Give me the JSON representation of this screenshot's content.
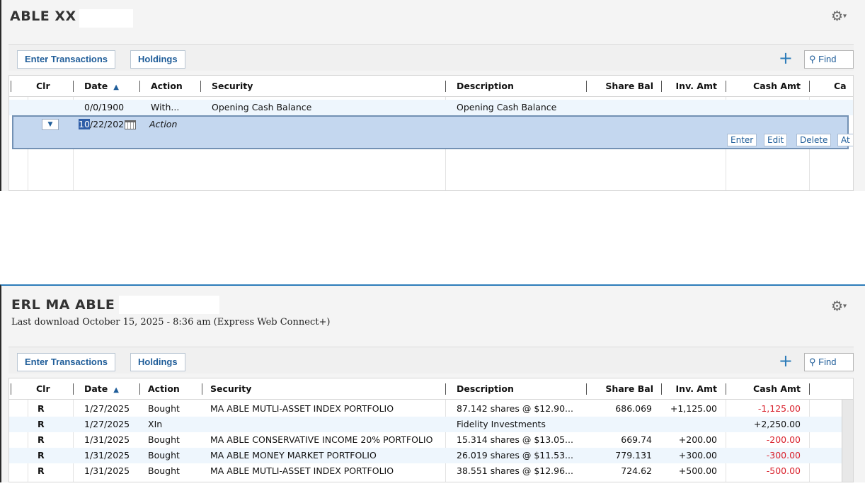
{
  "panel1": {
    "title": "ABLE XX",
    "toolbar": {
      "enter_label": "Enter Transactions",
      "holdings_label": "Holdings",
      "find_label": "Find"
    },
    "columns": [
      "Clr",
      "Date",
      "Action",
      "Security",
      "Description",
      "Share Bal",
      "Inv. Amt",
      "Cash Amt",
      "Ca"
    ],
    "rows": [
      {
        "clr": "",
        "date": "0/0/1900",
        "action": "With...",
        "security": "Opening Cash Balance",
        "description": "Opening Cash Balance",
        "share_bal": "",
        "inv_amt": "",
        "cash_amt": ""
      }
    ],
    "edit_row": {
      "date_selected": "10",
      "date_rest": "/22/202",
      "action_placeholder": "Action",
      "buttons": {
        "enter": "Enter",
        "edit": "Edit",
        "delete": "Delete",
        "attach": "At"
      }
    }
  },
  "panel2": {
    "title": "ERL MA ABLE",
    "subtitle": "Last download October 15, 2025 - 8:36 am (Express Web Connect+)",
    "toolbar": {
      "enter_label": "Enter Transactions",
      "holdings_label": "Holdings",
      "find_label": "Find"
    },
    "columns": [
      "Clr",
      "Date",
      "Action",
      "Security",
      "Description",
      "Share Bal",
      "Inv. Amt",
      "Cash Amt"
    ],
    "rows": [
      {
        "clr": "R",
        "date": "1/27/2025",
        "action": "Bought",
        "security": "MA ABLE MUTLI-ASSET INDEX PORTFOLIO",
        "description": "87.142 shares @ $12.90...",
        "share_bal": "686.069",
        "inv_amt": "+1,125.00",
        "cash_amt": "-1,125.00"
      },
      {
        "clr": "R",
        "date": "1/27/2025",
        "action": "XIn",
        "security": "",
        "description": "Fidelity Investments",
        "share_bal": "",
        "inv_amt": "",
        "cash_amt": "+2,250.00"
      },
      {
        "clr": "R",
        "date": "1/31/2025",
        "action": "Bought",
        "security": "MA ABLE CONSERVATIVE INCOME 20% PORTFOLIO",
        "description": "15.314 shares @ $13.05...",
        "share_bal": "669.74",
        "inv_amt": "+200.00",
        "cash_amt": "-200.00"
      },
      {
        "clr": "R",
        "date": "1/31/2025",
        "action": "Bought",
        "security": "MA ABLE MONEY MARKET PORTFOLIO",
        "description": "26.019 shares @ $11.53...",
        "share_bal": "779.131",
        "inv_amt": "+300.00",
        "cash_amt": "-300.00"
      },
      {
        "clr": "R",
        "date": "1/31/2025",
        "action": "Bought",
        "security": "MA ABLE MUTLI-ASSET INDEX PORTFOLIO",
        "description": "38.551 shares @ $12.96...",
        "share_bal": "724.62",
        "inv_amt": "+500.00",
        "cash_amt": "-500.00"
      }
    ]
  },
  "icons": {
    "gear": "gear-icon",
    "plus": "plus-icon",
    "find": "search-icon",
    "sort": "sort-ascending-icon",
    "dropdown": "chevron-down-icon",
    "calendar": "calendar-icon"
  },
  "colors": {
    "accent": "#2b7bb9",
    "link": "#1f5d99",
    "negative": "#d9212c",
    "edit_row": "#c4d7ef"
  }
}
